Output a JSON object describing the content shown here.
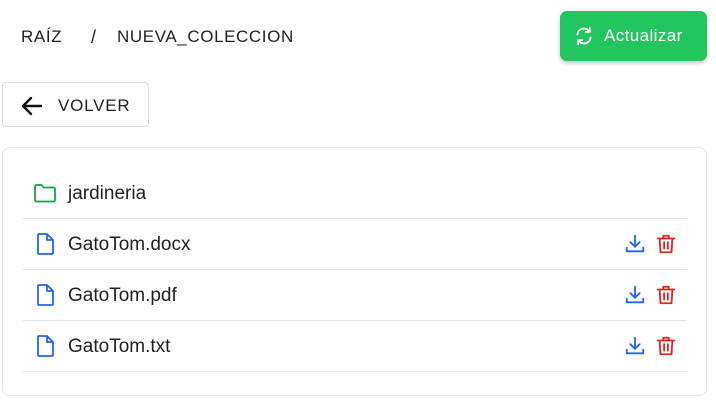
{
  "breadcrumb": {
    "root": "RAÍZ",
    "separator": "/",
    "current": "NUEVA_COLECCION"
  },
  "toolbar": {
    "refresh_label": "Actualizar",
    "refresh_icon": "refresh-icon",
    "back_label": "VOLVER",
    "back_icon": "arrow-left-icon"
  },
  "items": [
    {
      "name": "jardineria",
      "type": "folder",
      "icon": "folder-icon"
    },
    {
      "name": "GatoTom.docx",
      "type": "file",
      "icon": "file-icon",
      "actions": [
        "download-icon",
        "trash-icon"
      ]
    },
    {
      "name": "GatoTom.pdf",
      "type": "file",
      "icon": "file-icon",
      "actions": [
        "download-icon",
        "trash-icon"
      ]
    },
    {
      "name": "GatoTom.txt",
      "type": "file",
      "icon": "file-icon",
      "actions": [
        "download-icon",
        "trash-icon"
      ]
    }
  ],
  "colors": {
    "accent_green": "#22c55e",
    "folder_green": "#16a34a",
    "file_blue": "#2563eb",
    "download_blue": "#2563eb",
    "delete_red": "#dc2626"
  }
}
